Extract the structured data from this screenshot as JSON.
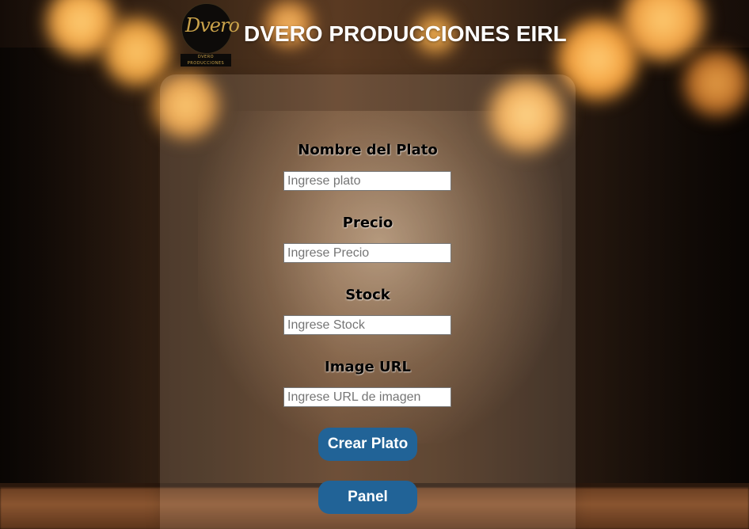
{
  "header": {
    "title": "DVERO PRODUCCIONES EIRL",
    "logo_text": "Dvero",
    "logo_subtext": "DVERO PRODUCCIONES"
  },
  "form": {
    "fields": [
      {
        "label": "Nombre del Plato",
        "placeholder": "Ingrese plato"
      },
      {
        "label": "Precio",
        "placeholder": "Ingrese Precio"
      },
      {
        "label": "Stock",
        "placeholder": "Ingrese Stock"
      },
      {
        "label": "Image URL",
        "placeholder": "Ingrese URL de imagen"
      }
    ],
    "submit_label": "Crear Plato",
    "panel_label": "Panel"
  },
  "colors": {
    "button_bg": "#216397",
    "title_text": "#ffffff",
    "logo_gold": "#c9a24a"
  }
}
